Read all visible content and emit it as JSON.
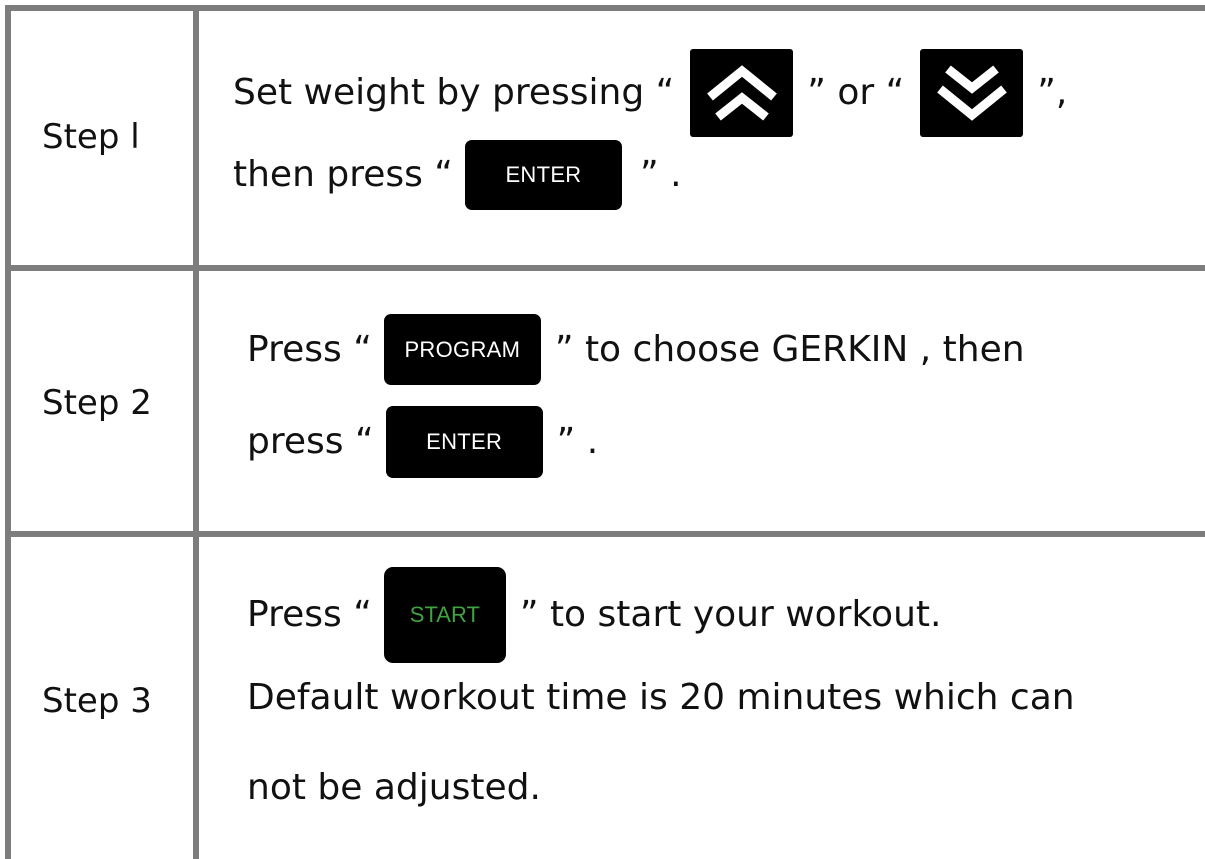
{
  "rows": [
    {
      "label": "Step l",
      "line1": {
        "pre": "Set weight by pressing “",
        "mid": "” or “",
        "post": "”,"
      },
      "line2": {
        "pre": "then press “",
        "key": "ENTER",
        "post": "” ."
      }
    },
    {
      "label": "Step 2",
      "line1": {
        "pre": "Press “",
        "key": "PROGRAM",
        "post": "” to choose GERKIN , then"
      },
      "line2": {
        "pre": "press “",
        "key": "ENTER",
        "post": "” ."
      }
    },
    {
      "label": "Step 3",
      "line1": {
        "pre": "Press “",
        "key": "START",
        "post": "”  to start your workout."
      },
      "line2": "Default workout time is 20 minutes which can",
      "line3": "not be adjusted."
    }
  ],
  "icons": {
    "up": "chevron-double-up-icon",
    "down": "chevron-double-down-icon"
  },
  "colors": {
    "grid": "#7d7d7d",
    "key_bg": "#000000",
    "start_text": "#3fa33f"
  }
}
